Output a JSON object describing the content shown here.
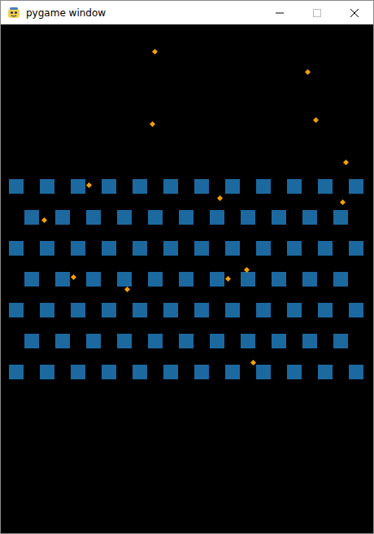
{
  "window": {
    "title": "pygame window"
  },
  "peg_rows": [
    {
      "pegs": 12,
      "shifted": false
    },
    {
      "pegs": 11,
      "shifted": true
    },
    {
      "pegs": 12,
      "shifted": false
    },
    {
      "pegs": 11,
      "shifted": true
    },
    {
      "pegs": 12,
      "shifted": false
    },
    {
      "pegs": 11,
      "shifted": true
    },
    {
      "pegs": 12,
      "shifted": false
    }
  ],
  "particle_count": 14
}
